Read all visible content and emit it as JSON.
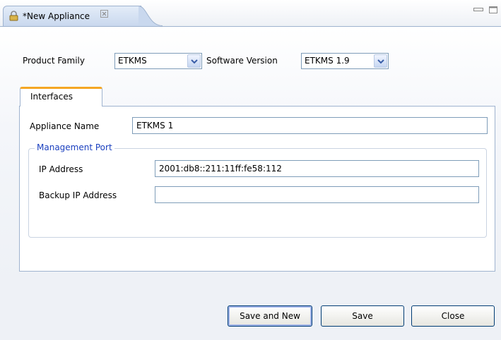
{
  "editor_tab": {
    "title": "*New Appliance",
    "close_glyph": "⊠"
  },
  "form": {
    "product_family": {
      "label": "Product Family",
      "value": "ETKMS"
    },
    "software_version": {
      "label": "Software Version",
      "value": "ETKMS 1.9"
    }
  },
  "tabs": [
    {
      "label": "Interfaces"
    }
  ],
  "interfaces": {
    "appliance_name": {
      "label": "Appliance Name",
      "value": "ETKMS 1"
    },
    "management_port": {
      "title": "Management Port",
      "ip_address": {
        "label": "IP Address",
        "value": "2001:db8::211:11ff:fe58:112"
      },
      "backup_ip_address": {
        "label": "Backup IP Address",
        "value": ""
      }
    }
  },
  "buttons": {
    "save_and_new": "Save and New",
    "save": "Save",
    "close": "Close"
  },
  "colors": {
    "tab_accent": "#f5a623",
    "group_title": "#1a3fbf",
    "field_border": "#7f9db9"
  }
}
